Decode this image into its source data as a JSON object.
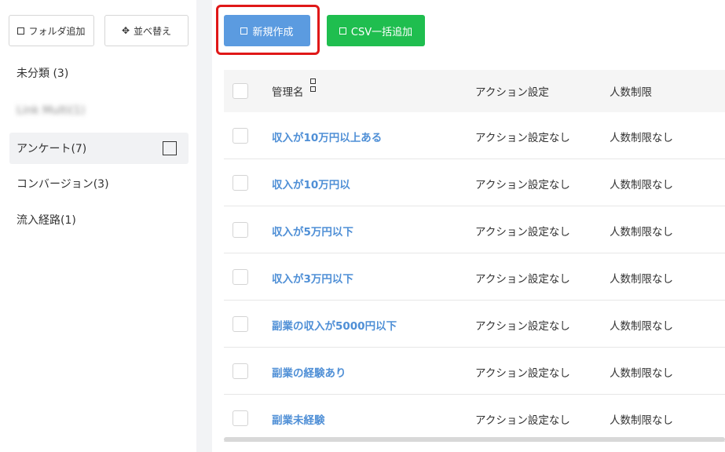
{
  "sidebar": {
    "add_folder_label": "フォルダ追加",
    "sort_label": "並べ替え",
    "folders": [
      {
        "label": "未分類 (3)"
      },
      {
        "label": "Link Multi(1)"
      },
      {
        "label": "アンケート(7)"
      },
      {
        "label": "コンバージョン(3)"
      },
      {
        "label": "流入経路(1)"
      }
    ]
  },
  "toolbar": {
    "new_label": "新規作成",
    "csv_label": "CSV一括追加"
  },
  "table": {
    "headers": {
      "name": "管理名",
      "action": "アクション設定",
      "limit": "人数制限"
    },
    "rows": [
      {
        "name": "収入が10万円以上ある",
        "action": "アクション設定なし",
        "limit": "人数制限なし"
      },
      {
        "name": "収入が10万円以",
        "action": "アクション設定なし",
        "limit": "人数制限なし"
      },
      {
        "name": "収入が5万円以下",
        "action": "アクション設定なし",
        "limit": "人数制限なし"
      },
      {
        "name": "収入が3万円以下",
        "action": "アクション設定なし",
        "limit": "人数制限なし"
      },
      {
        "name": "副業の収入が5000円以下",
        "action": "アクション設定なし",
        "limit": "人数制限なし"
      },
      {
        "name": "副業の経験あり",
        "action": "アクション設定なし",
        "limit": "人数制限なし"
      },
      {
        "name": "副業未経験",
        "action": "アクション設定なし",
        "limit": "人数制限なし"
      }
    ]
  },
  "colors": {
    "primary": "#5b9be0",
    "success": "#1fbe4f",
    "highlight": "#e01818",
    "link": "#4f8fd6"
  }
}
